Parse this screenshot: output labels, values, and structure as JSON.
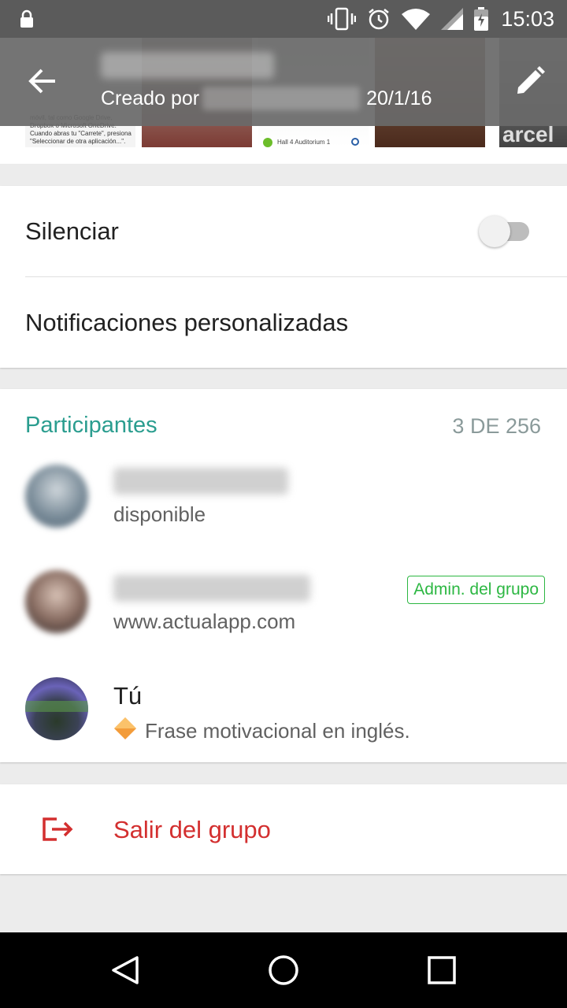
{
  "status_bar": {
    "time": "15:03",
    "icons": [
      "lock-icon",
      "vibrate-icon",
      "alarm-icon",
      "wifi-icon",
      "signal-icon",
      "battery-charging-icon"
    ]
  },
  "app_bar": {
    "created_by_prefix": "Creado por",
    "created_date": "20/1/16",
    "back_icon": "arrow-back-icon",
    "edit_icon": "pencil-icon"
  },
  "media_strip": {
    "thumb1_text": "móvil, tal como Google Drive, Dropbox o Microsoft OneDrive. Cuando abras tu \"Carrete\", presiona \"Seleccionar de otra aplicación...\".",
    "thumb3_caption": "Hall 4 Auditorium 1",
    "thumb5_word": "arcel"
  },
  "settings": {
    "mute_label": "Silenciar",
    "mute_enabled": false,
    "custom_notifications_label": "Notificaciones personalizadas"
  },
  "participants": {
    "title": "Participantes",
    "count": "3 DE 256",
    "items": [
      {
        "status": "disponible",
        "admin": false
      },
      {
        "status": "www.actualapp.com",
        "admin": true,
        "badge": "Admin. del grupo"
      },
      {
        "name": "Tú",
        "status": "Frase motivacional en inglés.",
        "status_icon": "orange-diamond-icon"
      }
    ]
  },
  "exit": {
    "label": "Salir del grupo",
    "icon": "exit-icon",
    "color": "#d32f2f"
  },
  "colors": {
    "accent": "#2a9d8f",
    "admin_badge": "#2cb742",
    "app_bar": "#696969"
  },
  "nav_bar": {
    "icons": [
      "back-triangle-icon",
      "home-circle-icon",
      "recents-square-icon"
    ]
  }
}
